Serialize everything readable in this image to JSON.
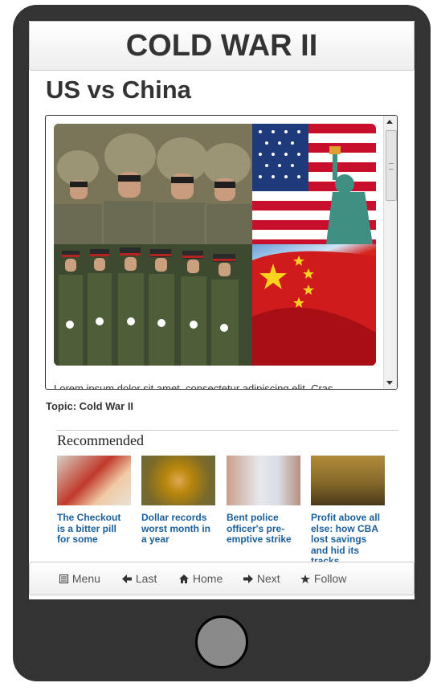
{
  "app": {
    "title": "COLD WAR II"
  },
  "article": {
    "title": "US vs China",
    "image_alt": "US soldiers, American flag and Statue of Liberty; Chinese soldiers and Chinese flag",
    "body_preview": "Lorem ipsum dolor sit amet, consectetur adipiscing elit. Cras",
    "topic": "Topic: Cold War II"
  },
  "recommended": {
    "heading": "Recommended",
    "items": [
      {
        "caption": "The Checkout is a bitter pill for some",
        "thumb_color": "#c0392b"
      },
      {
        "caption": "Dollar records worst month in a year",
        "thumb_color": "#b8860b"
      },
      {
        "caption": "Bent police officer's pre-emptive strike",
        "thumb_color": "#c9b7a6"
      },
      {
        "caption": "Profit above all else: how CBA lost savings and hid its tracks",
        "thumb_color": "#8a6d2a"
      }
    ]
  },
  "nav": [
    {
      "label": "Menu",
      "icon": "list-icon"
    },
    {
      "label": "Last",
      "icon": "arrow-left-icon"
    },
    {
      "label": "Home",
      "icon": "home-icon"
    },
    {
      "label": "Next",
      "icon": "arrow-right-icon"
    },
    {
      "label": "Follow",
      "icon": "star-icon"
    }
  ],
  "colors": {
    "phone_body": "#333333",
    "link": "#1a5f99",
    "text": "#333333"
  }
}
